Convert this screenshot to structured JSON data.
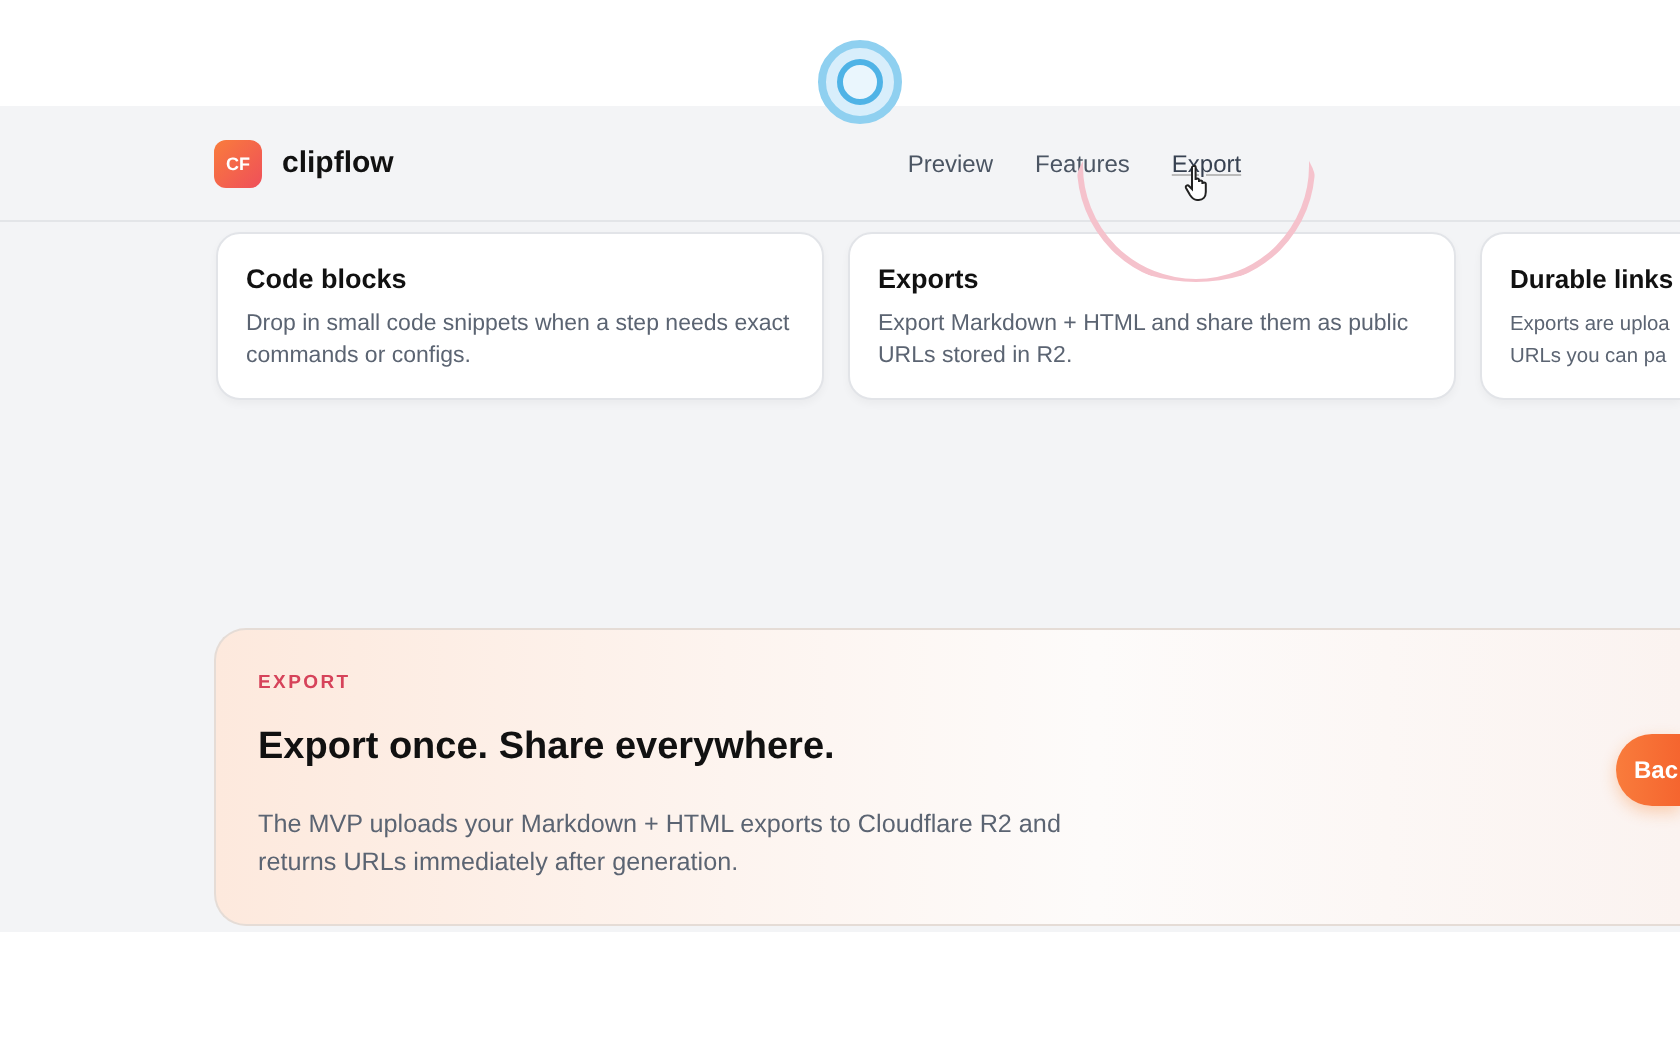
{
  "header": {
    "logo_badge": "CF",
    "brand": "clipflow",
    "nav": [
      {
        "label": "Preview",
        "hovered": false
      },
      {
        "label": "Features",
        "hovered": false
      },
      {
        "label": "Export",
        "hovered": true
      }
    ]
  },
  "features": [
    {
      "title": "Code blocks",
      "text": "Drop in small code snippets when a step needs exact commands or configs.",
      "cut": false
    },
    {
      "title": "Exports",
      "text": "Export Markdown + HTML and share them as public URLs stored in R2.",
      "cut": false
    },
    {
      "title": "Durable links",
      "text": "Exports are uploa\nURLs you can pa",
      "cut": true
    }
  ],
  "banner": {
    "eyebrow": "EXPORT",
    "heading": "Export once. Share everywhere.",
    "text": "The MVP uploads your Markdown + HTML exports to Cloudflare R2 and returns URLs immediately after generation.",
    "button": "Bac"
  }
}
